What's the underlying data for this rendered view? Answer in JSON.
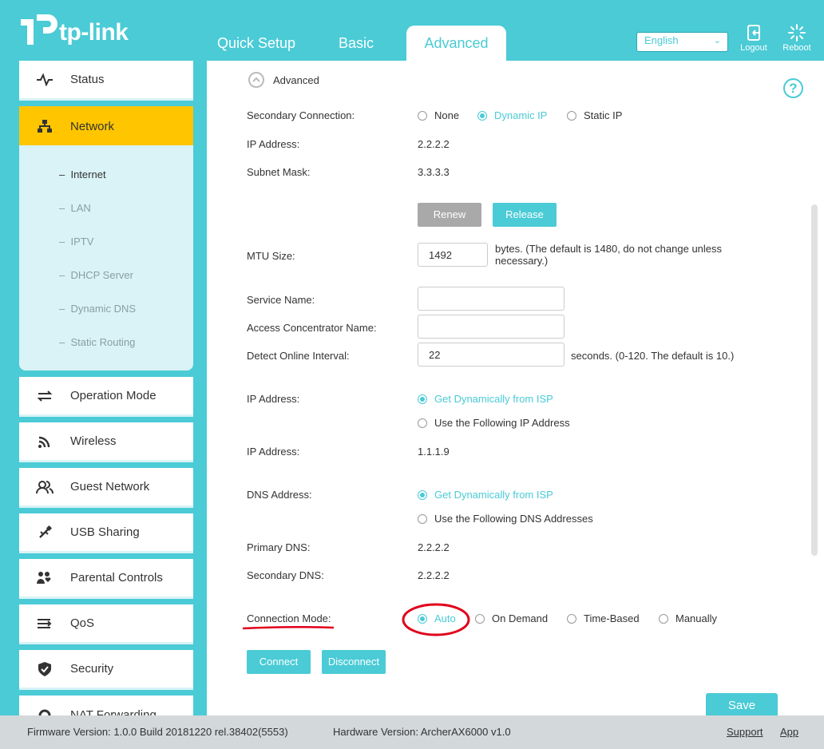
{
  "header": {
    "brand": "tp-link",
    "tabs": [
      {
        "label": "Quick Setup"
      },
      {
        "label": "Basic"
      },
      {
        "label": "Advanced"
      }
    ],
    "active_tab": "Advanced",
    "language": "English",
    "logout_label": "Logout",
    "reboot_label": "Reboot"
  },
  "sidebar": {
    "items": [
      {
        "label": "Status",
        "icon": "pulse-icon"
      },
      {
        "label": "Network",
        "icon": "network-icon"
      },
      {
        "label": "Operation Mode",
        "icon": "swap-icon"
      },
      {
        "label": "Wireless",
        "icon": "wifi-icon"
      },
      {
        "label": "Guest Network",
        "icon": "users-icon"
      },
      {
        "label": "USB Sharing",
        "icon": "usb-icon"
      },
      {
        "label": "Parental Controls",
        "icon": "family-icon"
      },
      {
        "label": "QoS",
        "icon": "qos-icon"
      },
      {
        "label": "Security",
        "icon": "shield-icon"
      },
      {
        "label": "NAT Forwarding",
        "icon": "nat-icon"
      }
    ],
    "network_sub": [
      "Internet",
      "LAN",
      "IPTV",
      "DHCP Server",
      "Dynamic DNS",
      "Static Routing"
    ],
    "current_sub": "Internet"
  },
  "main": {
    "section_title": "Advanced",
    "secondary_connection": {
      "label": "Secondary Connection:",
      "options": [
        "None",
        "Dynamic IP",
        "Static IP"
      ],
      "selected": "Dynamic IP"
    },
    "ip_address_label": "IP Address:",
    "ip_address_value": "2.2.2.2",
    "subnet_mask_label": "Subnet Mask:",
    "subnet_mask_value": "3.3.3.3",
    "renew_label": "Renew",
    "release_label": "Release",
    "mtu_label": "MTU Size:",
    "mtu_value": "1492",
    "mtu_note": "bytes. (The default is 1480, do not change unless necessary.)",
    "service_name_label": "Service Name:",
    "service_name_value": "",
    "access_concentrator_label": "Access Concentrator Name:",
    "access_concentrator_value": "",
    "detect_interval_label": "Detect Online Interval:",
    "detect_interval_value": "22",
    "detect_interval_note": "seconds. (0-120. The default is 10.)",
    "ip_mode_label": "IP Address:",
    "ip_mode_options": [
      "Get Dynamically from ISP",
      "Use the Following IP Address"
    ],
    "ip_mode_selected": "Get Dynamically from ISP",
    "ip_address2_label": "IP Address:",
    "ip_address2_value": "1.1.1.9",
    "dns_label": "DNS Address:",
    "dns_options": [
      "Get Dynamically from ISP",
      "Use the Following DNS Addresses"
    ],
    "dns_selected": "Get Dynamically from ISP",
    "primary_dns_label": "Primary DNS:",
    "primary_dns_value": "2.2.2.2",
    "secondary_dns_label": "Secondary DNS:",
    "secondary_dns_value": "2.2.2.2",
    "connection_mode_label": "Connection Mode:",
    "connection_mode_options": [
      "Auto",
      "On Demand",
      "Time-Based",
      "Manually"
    ],
    "connection_mode_selected": "Auto",
    "connect_label": "Connect",
    "disconnect_label": "Disconnect",
    "save_label": "Save"
  },
  "footer": {
    "firmware": "Firmware Version: 1.0.0 Build 20181220 rel.38402(5553)",
    "hardware": "Hardware Version: ArcherAX6000 v1.0",
    "support": "Support",
    "app": "App"
  },
  "colors": {
    "accent": "#4acbd6",
    "active_menu": "#ffc600",
    "annotation": "#e0001a"
  }
}
